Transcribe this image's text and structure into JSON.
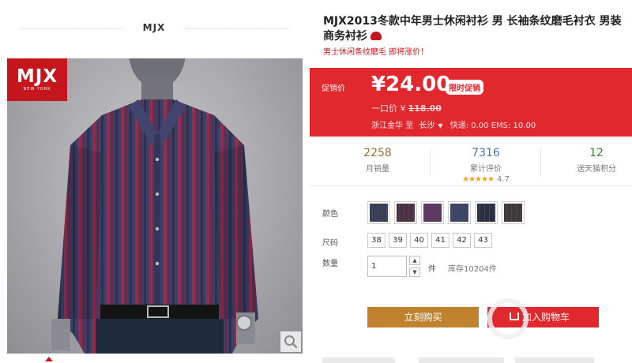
{
  "brand": {
    "name": "MJX",
    "logo_text": "MJX",
    "logo_subtext": "NEW YORK"
  },
  "product": {
    "title": "MJX2013冬款中年男士休闲衬衫 男 长袖条纹磨毛衬衣 男装商务衬衫",
    "subtitle": "男士休闲条纹磨毛 即将涨价！"
  },
  "price": {
    "label": "促销价",
    "current": "¥24.00",
    "promo_badge": "限时促销",
    "original_label": "一口价 ¥",
    "original_value": "118.00",
    "ship_from": "浙江金华",
    "ship_to_label": "至",
    "ship_to": "长沙",
    "shipping": "快递: 0.00 EMS: 10.00"
  },
  "stats": [
    {
      "value": "2258",
      "label": "月销量"
    },
    {
      "value": "7316",
      "label": "累计评价",
      "rating": "4.7",
      "stars": "★★★★★"
    },
    {
      "value": "12",
      "label": "送天猫积分"
    }
  ],
  "options": {
    "color_label": "颜色",
    "colors": [
      "#3a3f58",
      "#4b3242",
      "#5a3b5f",
      "#3d4464",
      "#2a2f3f",
      "#3f3838"
    ],
    "size_label": "尺码",
    "sizes": [
      "38",
      "39",
      "40",
      "41",
      "42",
      "43"
    ],
    "quantity_label": "数量",
    "quantity": "1",
    "unit": "件",
    "stock": "库存10204件"
  },
  "actions": {
    "buy_now": "立刻购买",
    "add_to_cart": "加入购物车"
  },
  "colors": {
    "accent_red": "#e0282e",
    "buy_brown": "#c0822e",
    "brand_red": "#c4161c"
  }
}
